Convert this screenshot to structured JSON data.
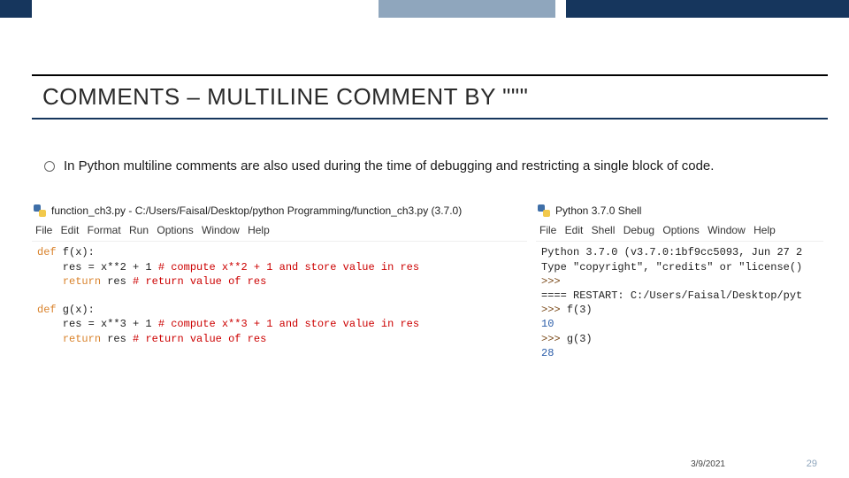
{
  "title": "COMMENTS – MULTILINE COMMENT BY \"\"\"",
  "bullet": "In Python multiline comments are also used during the time of debugging and restricting a single block of code.",
  "editor": {
    "window_title": "function_ch3.py - C:/Users/Faisal/Desktop/python Programming/function_ch3.py (3.7.0)",
    "menu": "File  Edit  Format  Run  Options  Window  Help",
    "l1a": "def",
    "l1b": " f(x):",
    "l2a": "    res = x**2 + 1 ",
    "l2b": "# compute x**2 + 1 and store value in res",
    "l3a": "    ",
    "l3b": "return",
    "l3c": " res ",
    "l3d": "# return value of res",
    "l4a": "def",
    "l4b": " g(x):",
    "l5a": "    res = x**3 + 1 ",
    "l5b": "# compute x**3 + 1 and store value in res",
    "l6a": "    ",
    "l6b": "return",
    "l6c": " res ",
    "l6d": "# return value of res"
  },
  "shell": {
    "window_title": "Python 3.7.0 Shell",
    "menu": "File  Edit  Shell  Debug  Options  Window  Help",
    "s1": "Python 3.7.0 (v3.7.0:1bf9cc5093, Jun 27 2",
    "s2": "Type \"copyright\", \"credits\" or \"license()",
    "p1": ">>> ",
    "s3": "==== RESTART: C:/Users/Faisal/Desktop/pyt",
    "p2": ">>> ",
    "s4": "f(3)",
    "o1": "10",
    "p3": ">>> ",
    "s5": "g(3)",
    "o2": "28"
  },
  "footer": {
    "date": "3/9/2021",
    "page": "29"
  }
}
